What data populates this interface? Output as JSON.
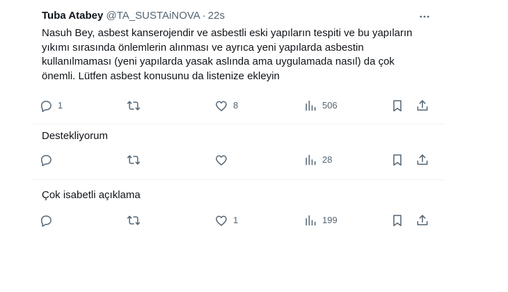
{
  "tweets": [
    {
      "author_name": "Tuba Atabey",
      "handle": "@TA_SUSTAiNOVA",
      "separator": "·",
      "time": "22s",
      "text": "Nasuh Bey, asbest kanserojendir ve asbestli eski yapıların tespiti ve bu yapıların yıkımı sırasında önlemlerin alınması ve ayrıca yeni yapılarda asbestin kullanılmaması (yeni yapılarda yasak aslında ama uygulamada nasıl) da çok önemli. Lütfen asbest konusunu da listenize ekleyin",
      "reply_count": "1",
      "retweet_count": "",
      "like_count": "8",
      "view_count": "506"
    },
    {
      "text": "Destekliyorum",
      "reply_count": "",
      "retweet_count": "",
      "like_count": "",
      "view_count": "28"
    },
    {
      "text": "Çok isabetli açıklama",
      "reply_count": "",
      "retweet_count": "",
      "like_count": "1",
      "view_count": "199"
    }
  ],
  "icons": {
    "reply": "reply-icon",
    "retweet": "retweet-icon",
    "like": "heart-icon",
    "views": "views-icon",
    "bookmark": "bookmark-icon",
    "share": "share-icon",
    "more": "more-icon"
  },
  "colors": {
    "text_primary": "#0f1419",
    "text_secondary": "#536471",
    "divider": "#eff3f4"
  }
}
